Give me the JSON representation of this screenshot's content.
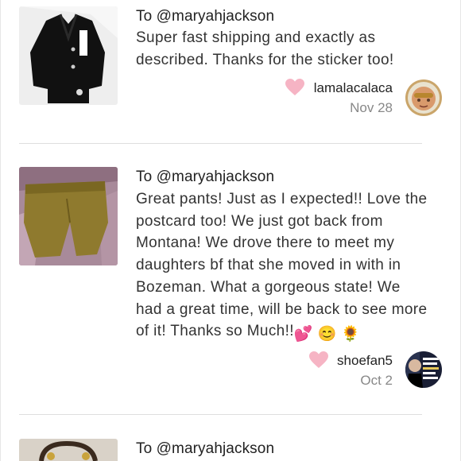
{
  "reviews": [
    {
      "to_label": "To @maryahjackson",
      "text": "Super fast shipping and exactly as described. Thanks for the sticker too!",
      "username": "lamalacalaca",
      "date": "Nov 28",
      "image": "black-jacket-photo",
      "avatar": "user-avatar-photo"
    },
    {
      "to_label": "To @maryahjackson",
      "text": "Great pants! Just as I expected!! Love the postcard too! We just got back from Montana! We drove there to meet my daughters bf that she moved in with in Bozeman. What a gorgeous state! We had a great time, will be back to see more of it! Thanks so Much!!",
      "emojis": [
        "💕",
        "😊",
        "🌻"
      ],
      "username": "shoefan5",
      "date": "Oct 2",
      "image": "olive-pants-photo",
      "avatar": "user-avatar-photo"
    },
    {
      "to_label": "To @maryahjackson",
      "image": "bag-photo"
    }
  ],
  "colors": {
    "heart": "#f6b4c4",
    "divider": "#dedede",
    "date": "#888888"
  }
}
